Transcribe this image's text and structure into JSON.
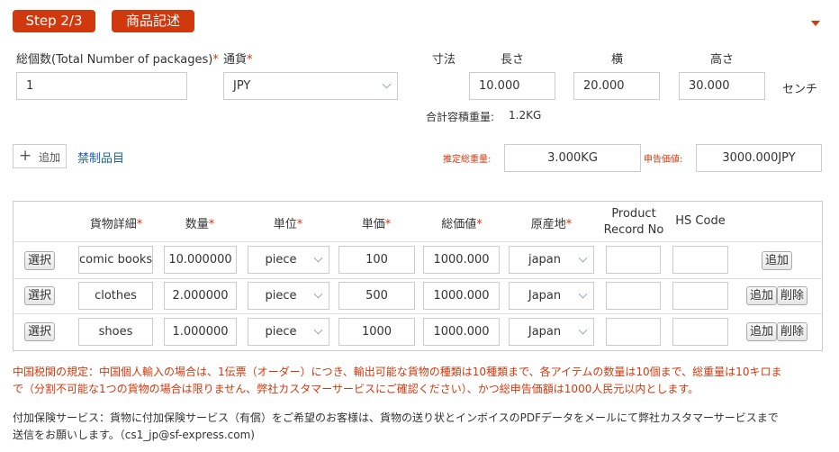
{
  "header": {
    "step_label": "Step 2/3",
    "section_label": "商品記述"
  },
  "form": {
    "total_packages_label": "総個数(Total Number of packages)",
    "total_packages_value": "1",
    "currency_label": "通貨",
    "currency_value": "JPY",
    "dimensions_label": "寸法",
    "length_label": "長さ",
    "width_label": "横",
    "height_label": "高さ",
    "length_value": "10.000",
    "width_value": "20.000",
    "height_value": "30.000",
    "unit_label": "センチ",
    "total_volume_weight_label": "合計容積重量:",
    "total_volume_weight_value": "1.2KG",
    "add_button_label": "追加",
    "prohibited_link": "禁制品目",
    "estimated_weight_label": "推定総重量:",
    "estimated_weight_value": "3.000KG",
    "declared_value_label": "申告価値:",
    "declared_value_value": "3000.000JPY",
    "required_mark": "*"
  },
  "table": {
    "headers": {
      "detail": "貨物詳細",
      "quantity": "数量",
      "unit": "単位",
      "unit_price": "単価",
      "total_value": "総価値",
      "origin": "原産地",
      "product_record_1": "Product",
      "product_record_2": "Record No",
      "hs_code": "HS Code"
    },
    "select_label": "選択",
    "add_label": "追加",
    "delete_label": "削除",
    "rows": [
      {
        "detail": "comic books",
        "quantity": "10.000000",
        "unit": "piece",
        "unit_price": "100",
        "total": "1000.000",
        "origin": "japan",
        "record": "",
        "hs": ""
      },
      {
        "detail": "clothes",
        "quantity": "2.000000",
        "unit": "piece",
        "unit_price": "500",
        "total": "1000.000",
        "origin": "Japan",
        "record": "",
        "hs": ""
      },
      {
        "detail": "shoes",
        "quantity": "1.000000",
        "unit": "piece",
        "unit_price": "1000",
        "total": "1000.000",
        "origin": "Japan",
        "record": "",
        "hs": ""
      }
    ]
  },
  "notes": {
    "customs_line1": "中国税関の規定：中国個人輸入の場合は、1伝票（オーダー）につき、輸出可能な貨物の種類は10種類まで、各アイテムの数量は10個まで、総重量は10キロま",
    "customs_line2": "で（分割不可能な1つの貨物の場合は限りません、弊社カスタマーサービスにご確認ください）、かつ総申告価額は1000人民元以内とします。",
    "insurance_line1": "付加保険サービス：貨物に付加保険サービス（有償）をご希望のお客様は、貨物の送り状とインボイスのPDFデータをメールにて弊社カスタマーサービスまで",
    "insurance_line2": "送信をお願いします。（cs1_jp@sf-express.com)"
  },
  "colors": {
    "accent": "#d0390e",
    "link": "#1a5fb4"
  }
}
